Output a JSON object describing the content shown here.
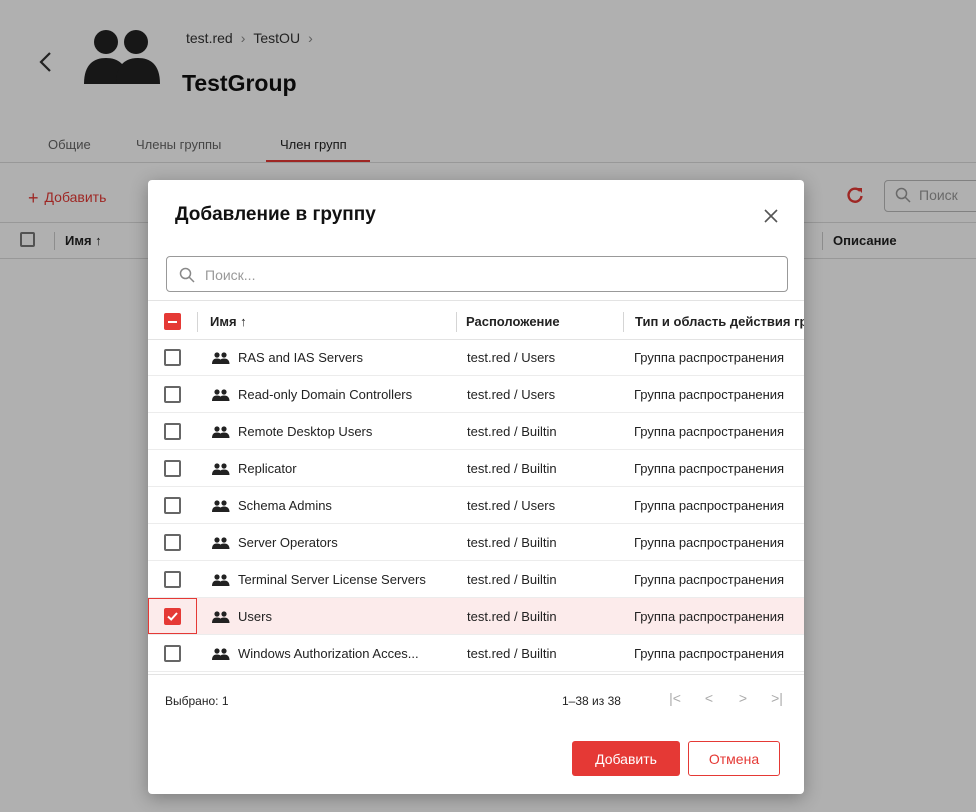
{
  "page": {
    "breadcrumb": [
      "test.red",
      "TestOU"
    ],
    "title": "TestGroup",
    "tabs": [
      "Общие",
      "Члены группы",
      "Член групп"
    ],
    "active_tab": 2,
    "toolbar": {
      "add_label": "Добавить",
      "search_placeholder": "Поиск"
    },
    "columns": {
      "name": "Имя ↑",
      "description": "Описание"
    }
  },
  "dialog": {
    "title": "Добавление в группу",
    "search_placeholder": "Поиск...",
    "columns": {
      "name": "Имя ↑",
      "location": "Расположение",
      "type": "Тип и область действия группы"
    },
    "rows": [
      {
        "name": "RAS and IAS Servers",
        "location": "test.red / Users",
        "type": "Группа распространения",
        "selected": false
      },
      {
        "name": "Read-only Domain Controllers",
        "location": "test.red / Users",
        "type": "Группа распространения",
        "selected": false
      },
      {
        "name": "Remote Desktop Users",
        "location": "test.red / Builtin",
        "type": "Группа распространения",
        "selected": false
      },
      {
        "name": "Replicator",
        "location": "test.red / Builtin",
        "type": "Группа распространения",
        "selected": false
      },
      {
        "name": "Schema Admins",
        "location": "test.red / Users",
        "type": "Группа распространения",
        "selected": false
      },
      {
        "name": "Server Operators",
        "location": "test.red / Builtin",
        "type": "Группа распространения",
        "selected": false
      },
      {
        "name": "Terminal Server License Servers",
        "location": "test.red / Builtin",
        "type": "Группа распространения",
        "selected": false
      },
      {
        "name": "Users",
        "location": "test.red / Builtin",
        "type": "Группа распространения",
        "selected": true
      },
      {
        "name": "Windows Authorization Acces...",
        "location": "test.red / Builtin",
        "type": "Группа распространения",
        "selected": false
      }
    ],
    "footer": {
      "selected_label": "Выбрано: 1",
      "range_label": "1–38 из 38"
    },
    "buttons": {
      "add": "Добавить",
      "cancel": "Отмена"
    }
  },
  "colors": {
    "accent": "#e53935",
    "overlay": "rgba(0,0,0,0.31)"
  },
  "icons": [
    "back-arrow-icon",
    "group-icon",
    "plus-icon",
    "refresh-icon",
    "search-icon",
    "close-icon",
    "checkmark-icon",
    "first-page-icon",
    "prev-page-icon",
    "next-page-icon",
    "last-page-icon"
  ]
}
